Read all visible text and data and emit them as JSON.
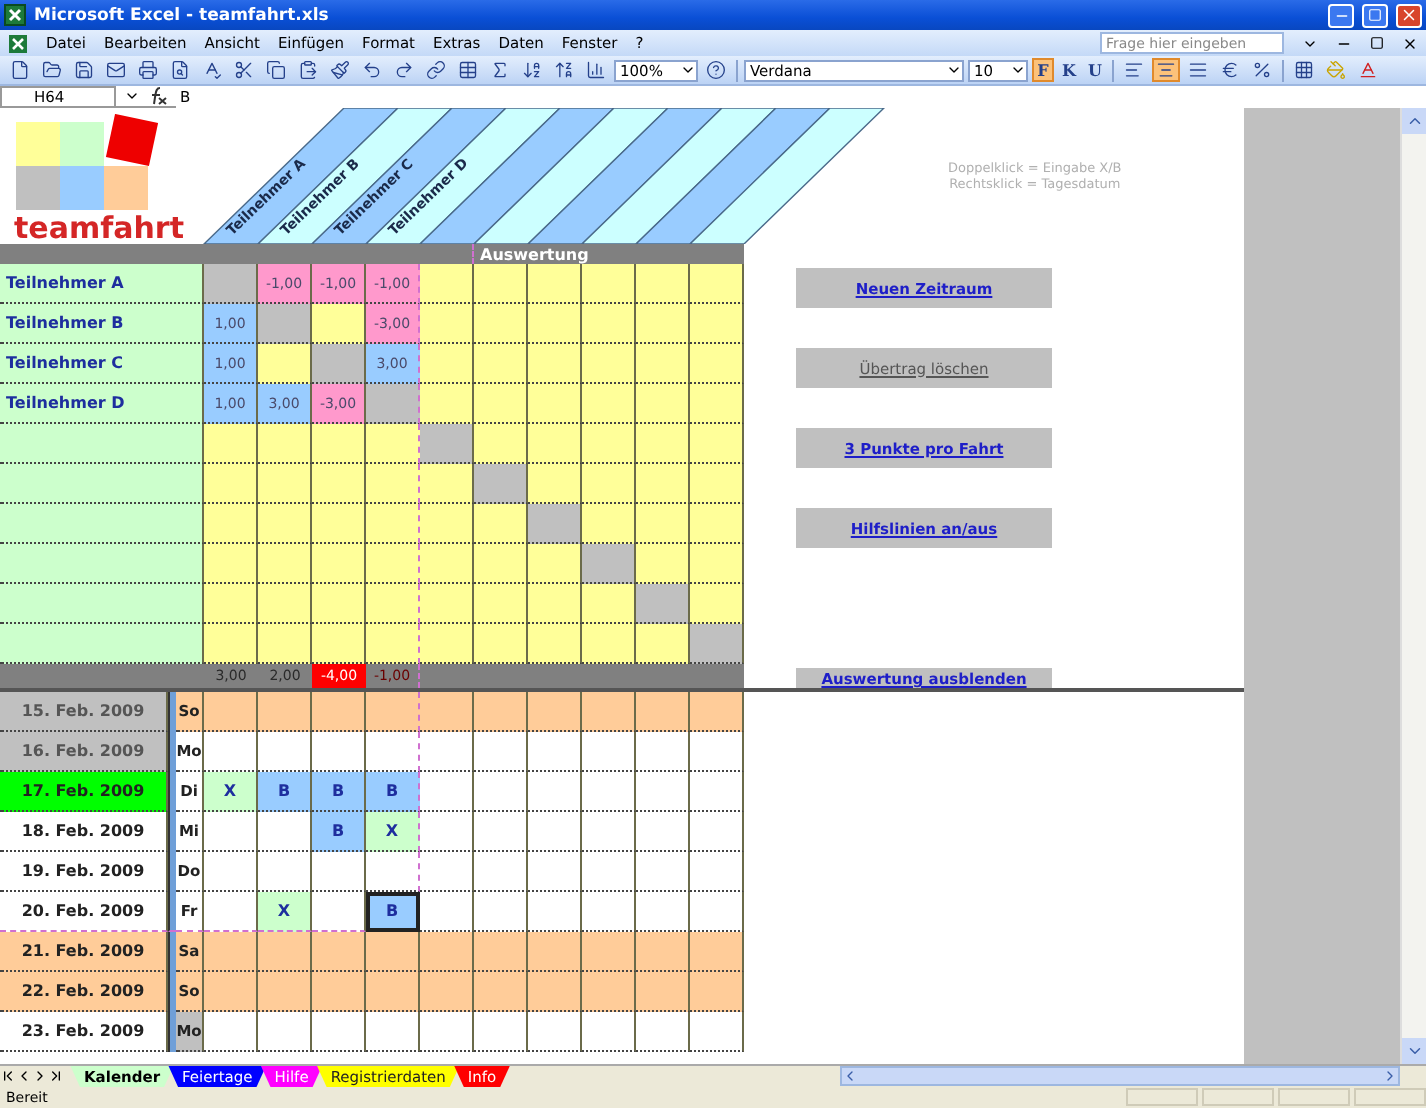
{
  "window": {
    "title": "Microsoft Excel - teamfahrt.xls"
  },
  "menu": [
    "Datei",
    "Bearbeiten",
    "Ansicht",
    "Einfügen",
    "Format",
    "Extras",
    "Daten",
    "Fenster",
    "?"
  ],
  "help_box": {
    "placeholder": "Frage hier eingeben"
  },
  "toolbar": {
    "zoom": "100%",
    "font": "Verdana",
    "font_size": "10",
    "format_buttons": [
      {
        "label": "F",
        "selected": true
      },
      {
        "label": "K",
        "selected": false
      },
      {
        "label": "U",
        "selected": false
      }
    ],
    "align_buttons": [
      {
        "kind": "left",
        "selected": false
      },
      {
        "kind": "center",
        "selected": true
      },
      {
        "kind": "merge",
        "selected": false
      }
    ]
  },
  "formula_bar": {
    "cell": "H64",
    "value": "B"
  },
  "logo": {
    "text": "teamfahrt"
  },
  "participant_headers": [
    "Teilnehmer A",
    "Teilnehmer B",
    "Teilnehmer C",
    "Teilnehmer D"
  ],
  "hints": [
    "Doppelklick = Eingabe X/B",
    "Rechtsklick = Tagesdatum"
  ],
  "matrix": {
    "header": "Auswertung",
    "guides_visible": true,
    "rows": [
      {
        "name": "Teilnehmer A",
        "cells": [
          {
            "kind": "diag"
          },
          {
            "kind": "neg",
            "text": "-1,00"
          },
          {
            "kind": "neg",
            "text": "-1,00"
          },
          {
            "kind": "neg",
            "text": "-1,00"
          },
          {
            "kind": "empty"
          },
          {
            "kind": "empty"
          },
          {
            "kind": "empty"
          },
          {
            "kind": "empty"
          },
          {
            "kind": "empty"
          },
          {
            "kind": "empty"
          }
        ]
      },
      {
        "name": "Teilnehmer B",
        "cells": [
          {
            "kind": "pos",
            "text": "1,00"
          },
          {
            "kind": "diag"
          },
          {
            "kind": "empty"
          },
          {
            "kind": "neg",
            "text": "-3,00"
          },
          {
            "kind": "empty"
          },
          {
            "kind": "empty"
          },
          {
            "kind": "empty"
          },
          {
            "kind": "empty"
          },
          {
            "kind": "empty"
          },
          {
            "kind": "empty"
          }
        ]
      },
      {
        "name": "Teilnehmer C",
        "cells": [
          {
            "kind": "pos",
            "text": "1,00"
          },
          {
            "kind": "empty"
          },
          {
            "kind": "diag"
          },
          {
            "kind": "pos",
            "text": "3,00"
          },
          {
            "kind": "empty"
          },
          {
            "kind": "empty"
          },
          {
            "kind": "empty"
          },
          {
            "kind": "empty"
          },
          {
            "kind": "empty"
          },
          {
            "kind": "empty"
          }
        ]
      },
      {
        "name": "Teilnehmer D",
        "cells": [
          {
            "kind": "pos",
            "text": "1,00"
          },
          {
            "kind": "pos",
            "text": "3,00"
          },
          {
            "kind": "neg",
            "text": "-3,00"
          },
          {
            "kind": "diag"
          },
          {
            "kind": "empty"
          },
          {
            "kind": "empty"
          },
          {
            "kind": "empty"
          },
          {
            "kind": "empty"
          },
          {
            "kind": "empty"
          },
          {
            "kind": "empty"
          }
        ]
      },
      {
        "cells": [
          {
            "kind": "empty"
          },
          {
            "kind": "empty"
          },
          {
            "kind": "empty"
          },
          {
            "kind": "empty"
          },
          {
            "kind": "diag"
          },
          {
            "kind": "empty"
          },
          {
            "kind": "empty"
          },
          {
            "kind": "empty"
          },
          {
            "kind": "empty"
          },
          {
            "kind": "empty"
          }
        ]
      },
      {
        "cells": [
          {
            "kind": "empty"
          },
          {
            "kind": "empty"
          },
          {
            "kind": "empty"
          },
          {
            "kind": "empty"
          },
          {
            "kind": "empty"
          },
          {
            "kind": "diag"
          },
          {
            "kind": "empty"
          },
          {
            "kind": "empty"
          },
          {
            "kind": "empty"
          },
          {
            "kind": "empty"
          }
        ]
      },
      {
        "cells": [
          {
            "kind": "empty"
          },
          {
            "kind": "empty"
          },
          {
            "kind": "empty"
          },
          {
            "kind": "empty"
          },
          {
            "kind": "empty"
          },
          {
            "kind": "empty"
          },
          {
            "kind": "diag"
          },
          {
            "kind": "empty"
          },
          {
            "kind": "empty"
          },
          {
            "kind": "empty"
          }
        ]
      },
      {
        "cells": [
          {
            "kind": "empty"
          },
          {
            "kind": "empty"
          },
          {
            "kind": "empty"
          },
          {
            "kind": "empty"
          },
          {
            "kind": "empty"
          },
          {
            "kind": "empty"
          },
          {
            "kind": "empty"
          },
          {
            "kind": "diag"
          },
          {
            "kind": "empty"
          },
          {
            "kind": "empty"
          }
        ]
      },
      {
        "cells": [
          {
            "kind": "empty"
          },
          {
            "kind": "empty"
          },
          {
            "kind": "empty"
          },
          {
            "kind": "empty"
          },
          {
            "kind": "empty"
          },
          {
            "kind": "empty"
          },
          {
            "kind": "empty"
          },
          {
            "kind": "empty"
          },
          {
            "kind": "diag"
          },
          {
            "kind": "empty"
          }
        ]
      },
      {
        "cells": [
          {
            "kind": "empty"
          },
          {
            "kind": "empty"
          },
          {
            "kind": "empty"
          },
          {
            "kind": "empty"
          },
          {
            "kind": "empty"
          },
          {
            "kind": "empty"
          },
          {
            "kind": "empty"
          },
          {
            "kind": "empty"
          },
          {
            "kind": "empty"
          },
          {
            "kind": "diag"
          }
        ]
      }
    ],
    "sums": [
      {
        "text": "3,00",
        "kind": "plain"
      },
      {
        "text": "2,00",
        "kind": "plain"
      },
      {
        "text": "-4,00",
        "kind": "alert"
      },
      {
        "text": "-1,00",
        "kind": "negative"
      }
    ]
  },
  "buttons": [
    {
      "label": "Neuen Zeitraum",
      "disabled": false
    },
    {
      "label": "Übertrag löschen",
      "disabled": true
    },
    {
      "label": "3 Punkte pro Fahrt",
      "disabled": false
    },
    {
      "label": "Hilfslinien an/aus",
      "disabled": false
    },
    {
      "label": "Auswertung ausblenden",
      "disabled": false
    }
  ],
  "calendar": [
    {
      "date": "15. Feb. 2009",
      "day": "So",
      "past": true,
      "today": false,
      "weekend": true,
      "day_marked": false,
      "entries": [
        {
          "kind": "empty",
          "selected": false
        },
        {
          "kind": "empty",
          "selected": false
        },
        {
          "kind": "empty",
          "selected": false
        },
        {
          "kind": "empty",
          "selected": false
        }
      ]
    },
    {
      "date": "16. Feb. 2009",
      "day": "Mo",
      "past": true,
      "today": false,
      "weekend": false,
      "day_marked": false,
      "entries": [
        {
          "kind": "empty",
          "selected": false
        },
        {
          "kind": "empty",
          "selected": false
        },
        {
          "kind": "empty",
          "selected": false
        },
        {
          "kind": "empty",
          "selected": false
        }
      ]
    },
    {
      "date": "17. Feb. 2009",
      "day": "Di",
      "past": false,
      "today": true,
      "weekend": false,
      "day_marked": false,
      "entries": [
        {
          "kind": "x",
          "text": "X",
          "selected": false
        },
        {
          "kind": "b",
          "text": "B",
          "selected": false
        },
        {
          "kind": "b",
          "text": "B",
          "selected": false
        },
        {
          "kind": "b",
          "text": "B",
          "selected": false
        }
      ]
    },
    {
      "date": "18. Feb. 2009",
      "day": "Mi",
      "past": false,
      "today": false,
      "weekend": false,
      "day_marked": false,
      "entries": [
        {
          "kind": "empty",
          "selected": false
        },
        {
          "kind": "empty",
          "selected": false
        },
        {
          "kind": "b",
          "text": "B",
          "selected": false
        },
        {
          "kind": "x",
          "text": "X",
          "selected": false
        }
      ]
    },
    {
      "date": "19. Feb. 2009",
      "day": "Do",
      "past": false,
      "today": false,
      "weekend": false,
      "day_marked": false,
      "entries": [
        {
          "kind": "empty",
          "selected": false
        },
        {
          "kind": "empty",
          "selected": false
        },
        {
          "kind": "empty",
          "selected": false
        },
        {
          "kind": "empty",
          "selected": false
        }
      ]
    },
    {
      "date": "20. Feb. 2009",
      "day": "Fr",
      "past": false,
      "today": false,
      "weekend": false,
      "day_marked": false,
      "entries": [
        {
          "kind": "empty",
          "selected": false
        },
        {
          "kind": "x",
          "text": "X",
          "selected": false
        },
        {
          "kind": "empty",
          "selected": false
        },
        {
          "kind": "b",
          "text": "B",
          "selected": true
        }
      ]
    },
    {
      "date": "21. Feb. 2009",
      "day": "Sa",
      "past": false,
      "today": false,
      "weekend": true,
      "day_marked": false,
      "entries": [
        {
          "kind": "empty",
          "selected": false
        },
        {
          "kind": "empty",
          "selected": false
        },
        {
          "kind": "empty",
          "selected": false
        },
        {
          "kind": "empty",
          "selected": false
        }
      ]
    },
    {
      "date": "22. Feb. 2009",
      "day": "So",
      "past": false,
      "today": false,
      "weekend": true,
      "day_marked": false,
      "entries": [
        {
          "kind": "empty",
          "selected": false
        },
        {
          "kind": "empty",
          "selected": false
        },
        {
          "kind": "empty",
          "selected": false
        },
        {
          "kind": "empty",
          "selected": false
        }
      ]
    },
    {
      "date": "23. Feb. 2009",
      "day": "Mo",
      "past": false,
      "today": false,
      "weekend": false,
      "day_marked": true,
      "entries": [
        {
          "kind": "empty",
          "selected": false
        },
        {
          "kind": "empty",
          "selected": false
        },
        {
          "kind": "empty",
          "selected": false
        },
        {
          "kind": "empty",
          "selected": false
        }
      ]
    }
  ],
  "sheet_tabs": [
    {
      "label": "Kalender",
      "selected": true,
      "color": "#ccffcc"
    },
    {
      "label": "Feiertage",
      "selected": false,
      "color": "#0000ff"
    },
    {
      "label": "Hilfe",
      "selected": false,
      "color": "#ff00ff"
    },
    {
      "label": "Registrierdaten",
      "selected": false,
      "color": "#ffff00"
    },
    {
      "label": "Info",
      "selected": false,
      "color": "#ff0000"
    }
  ],
  "status_bar": "Bereit"
}
